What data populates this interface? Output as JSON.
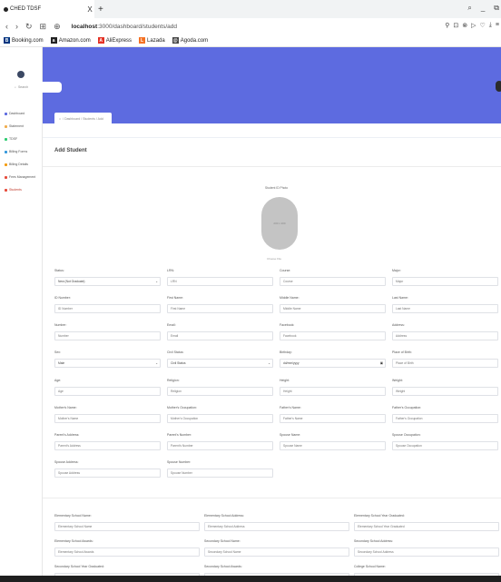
{
  "browser": {
    "tab_title": "CHED TDSF",
    "tab_close": "X",
    "new_tab": "+",
    "url_host": "localhost",
    "url_path": ":3000/dashboard/students/add",
    "bookmarks": [
      {
        "label": "Booking.com",
        "icon": "B",
        "color": "#003580"
      },
      {
        "label": "Amazon.com",
        "icon": "a",
        "color": "#222222"
      },
      {
        "label": "AliExpress",
        "icon": "A",
        "color": "#e43225"
      },
      {
        "label": "Lazada",
        "icon": "L",
        "color": "#f57224"
      },
      {
        "label": "Agoda.com",
        "icon": "@",
        "color": "#444444"
      }
    ]
  },
  "sidebar": {
    "items": [
      {
        "label": "Dashboard",
        "color": "#5d6be0"
      },
      {
        "label": "Statement",
        "color": "#f0ad4e"
      },
      {
        "label": "TDSF",
        "color": "#2ecc71"
      },
      {
        "label": "Billing Forms",
        "color": "#3498db"
      },
      {
        "label": "Billing Details",
        "color": "#f39c12"
      },
      {
        "label": "Fees Management",
        "color": "#e74c3c"
      },
      {
        "label": "Students",
        "color": "#e74c3c"
      }
    ]
  },
  "header": {
    "search_placeholder": "Search",
    "breadcrumb": "/ Dashboard / Students / Add",
    "accent_color": "#5d6be0"
  },
  "form": {
    "title": "Add Student",
    "photo_label": "Student ID Photo",
    "photo_placeholder": "200 x 200",
    "choose_file": "Choose File",
    "fields": [
      {
        "label": "Status:",
        "value": "New (Not Graduate)",
        "type": "select"
      },
      {
        "label": "LRN:",
        "placeholder": "LRN"
      },
      {
        "label": "Course:",
        "placeholder": "Course"
      },
      {
        "label": "Major:",
        "placeholder": "Major"
      },
      {
        "label": "ID Number:",
        "placeholder": "ID Number"
      },
      {
        "label": "First Name:",
        "placeholder": "First Name"
      },
      {
        "label": "Middle Name:",
        "placeholder": "Middle Name"
      },
      {
        "label": "Last Name:",
        "placeholder": "Last Name"
      },
      {
        "label": "Number:",
        "placeholder": "Number"
      },
      {
        "label": "Email:",
        "placeholder": "Email"
      },
      {
        "label": "Facebook:",
        "placeholder": "Facebook"
      },
      {
        "label": "Address:",
        "placeholder": "Address"
      },
      {
        "label": "Sex:",
        "value": "Male",
        "type": "select"
      },
      {
        "label": "Civil Status:",
        "value": "Civil Status",
        "type": "select"
      },
      {
        "label": "Birthday:",
        "value": "dd/mm/yyyy",
        "type": "date"
      },
      {
        "label": "Place of Birth:",
        "placeholder": "Place of Birth"
      },
      {
        "label": "Age:",
        "placeholder": "Age"
      },
      {
        "label": "Religion:",
        "placeholder": "Religion"
      },
      {
        "label": "Height:",
        "placeholder": "Height"
      },
      {
        "label": "Weight:",
        "placeholder": "Weight"
      },
      {
        "label": "Mother's Name:",
        "placeholder": "Mother's Name"
      },
      {
        "label": "Mother's Occupation:",
        "placeholder": "Mother's Occupation"
      },
      {
        "label": "Father's Name:",
        "placeholder": "Father's Name"
      },
      {
        "label": "Father's Occupation:",
        "placeholder": "Father's Occupation"
      },
      {
        "label": "Parent's Address:",
        "placeholder": "Parent's Address"
      },
      {
        "label": "Parent's Number:",
        "placeholder": "Parent's Number"
      },
      {
        "label": "Spouse Name:",
        "placeholder": "Spouse Name"
      },
      {
        "label": "Spouse Occupation:",
        "placeholder": "Spouse Occupation"
      },
      {
        "label": "Spouse Address:",
        "placeholder": "Spouse Address"
      },
      {
        "label": "Spouse Number:",
        "placeholder": "Spouse Number"
      }
    ],
    "education": [
      {
        "label": "Elementary School Name:",
        "placeholder": "Elementary School Name"
      },
      {
        "label": "Elementary School Address:",
        "placeholder": "Elementary School Address"
      },
      {
        "label": "Elementary School Year Graduated:",
        "placeholder": "Elementary School Year Graduated"
      },
      {
        "label": "Elementary School Awards:",
        "placeholder": "Elementary School Awards"
      },
      {
        "label": "Secondary School Name:",
        "placeholder": "Secondary School Name"
      },
      {
        "label": "Secondary School Address:",
        "placeholder": "Secondary School Address"
      },
      {
        "label": "Secondary School Year Graduated:",
        "placeholder": ""
      },
      {
        "label": "Secondary School Awards:",
        "placeholder": ""
      },
      {
        "label": "College School Name:",
        "placeholder": ""
      }
    ]
  }
}
